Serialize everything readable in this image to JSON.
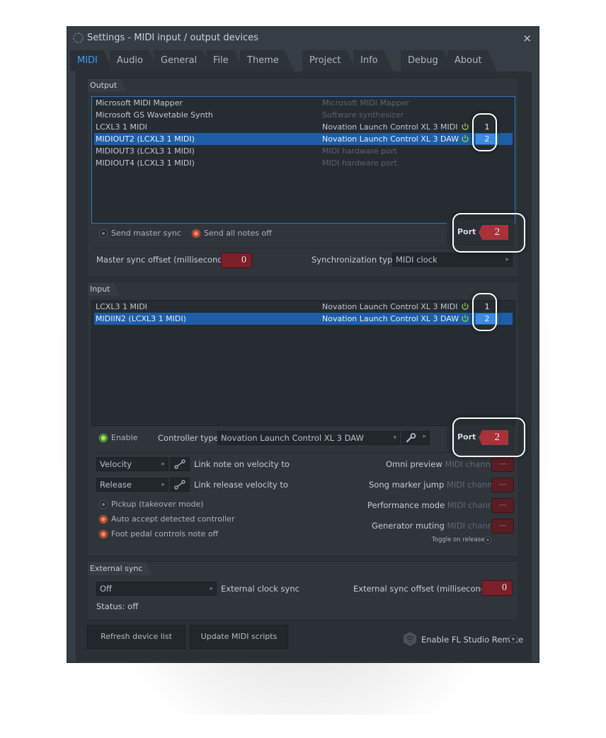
{
  "window": {
    "title": "Settings - MIDI input / output devices",
    "close": "×"
  },
  "tabs": [
    {
      "label": "MIDI",
      "active": true
    },
    {
      "label": "Audio"
    },
    {
      "label": "General"
    },
    {
      "label": "File"
    },
    {
      "label": "Theme"
    },
    {
      "label": "Project"
    },
    {
      "label": "Info"
    },
    {
      "label": "Debug"
    },
    {
      "label": "About"
    }
  ],
  "output": {
    "label": "Output",
    "devices": [
      {
        "name": "Microsoft MIDI Mapper",
        "desc": "Microsoft MIDI Mapper",
        "dim": true
      },
      {
        "name": "Microsoft GS Wavetable Synth",
        "desc": "Software synthesizer",
        "dim": true
      },
      {
        "name": "LCXL3 1 MIDI",
        "desc": "Novation Launch Control XL 3 MIDI",
        "port": "1"
      },
      {
        "name": "MIDIOUT2 (LCXL3 1 MIDI)",
        "desc": "Novation Launch Control XL 3 DAW",
        "port": "2",
        "selected": true
      },
      {
        "name": "MIDIOUT3 (LCXL3 1 MIDI)",
        "desc": "MIDI hardware port",
        "dim": true
      },
      {
        "name": "MIDIOUT4 (LCXL3 1 MIDI)",
        "desc": "MIDI hardware port",
        "dim": true
      }
    ],
    "send_master_sync": "Send master sync",
    "send_all_notes_off": "Send all notes off",
    "port_label": "Port",
    "port_value": "2",
    "master_sync_offset_label": "Master sync offset (milliseconds)",
    "master_sync_offset_value": "0",
    "sync_type_label": "Synchronization type",
    "sync_type_value": "MIDI clock"
  },
  "input": {
    "label": "Input",
    "devices": [
      {
        "name": "LCXL3 1 MIDI",
        "desc": "Novation Launch Control XL 3 MIDI",
        "port": "1"
      },
      {
        "name": "MIDIIN2 (LCXL3 1 MIDI)",
        "desc": "Novation Launch Control XL 3 DAW",
        "port": "2",
        "selected": true
      }
    ],
    "enable_label": "Enable",
    "controller_type_label": "Controller type",
    "controller_type_value": "Novation Launch Control XL 3 DAW",
    "port_label": "Port",
    "port_value": "2",
    "velocity_dropdown": "Velocity",
    "link_note_label": "Link note on velocity to",
    "release_dropdown": "Release",
    "link_release_label": "Link release velocity to",
    "pickup_label": "Pickup (takeover mode)",
    "auto_accept_label": "Auto accept detected controller",
    "foot_pedal_label": "Foot pedal controls note off",
    "omni_preview_label": "Omni preview",
    "song_marker_label": "Song marker jump",
    "performance_mode_label": "Performance mode",
    "generator_muting_label": "Generator muting",
    "midi_channel": "MIDI channel",
    "channel_value": "---",
    "toggle_on_release": "Toggle on release"
  },
  "external_sync": {
    "label": "External sync",
    "clock_value": "Off",
    "clock_label": "External clock sync",
    "offset_label": "External sync offset (milliseconds)",
    "offset_value": "0",
    "status": "Status: off"
  },
  "footer": {
    "refresh_button": "Refresh device list",
    "update_scripts_button": "Update MIDI scripts",
    "enable_remote_label": "Enable FL Studio Remote"
  },
  "colors": {
    "accent_blue": "#3d9ef4",
    "selection": "#1e5ea8",
    "port_red": "#a8323a",
    "power_green": "#8ed14b"
  }
}
